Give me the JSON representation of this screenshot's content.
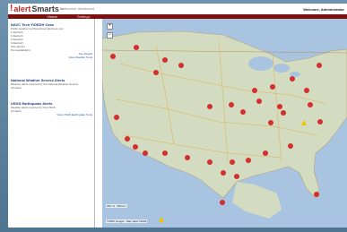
{
  "header": {
    "logo_bang": "!",
    "logo_alert": "alert",
    "logo_smarts": "Smarts",
    "logo_tm": "™",
    "product_text": "Enterprise dashboard",
    "welcome": "Welcome, Administrator"
  },
  "nav": {
    "home_label": "Home",
    "tab_label": "Settings"
  },
  "sidebar": {
    "panels": [
      {
        "title": "NAVC Tech Y/DEDH Cass",
        "lines": [
          "Public weather-vs Place/cloud alerts-ac.com",
          "1 Alerts(3)",
          "3 Alerts(4)",
          "1 Alerts(2)",
          "3 Alerts(2)",
          "UGI alert(1)",
          "Tool available(1)"
        ],
        "links": [
          "See Details",
          "View Weather Tools"
        ]
      },
      {
        "title": "National Weather Service Alerts",
        "lines": [
          "Weather alerts reported by the National Weather Service",
          "(5) alerts"
        ],
        "links": []
      },
      {
        "title": "USGS Earthquake Alerts",
        "lines": [
          "Weather alerts reported by the USGS",
          "(3) alerts"
        ],
        "links": [
          "View USGS Earthquake Tools"
        ]
      }
    ]
  },
  "map": {
    "zoom_in": "+",
    "zoom_out": "−",
    "scale": "200 mi · 500 km",
    "copyright": "©2009 Google - Map data ©2009",
    "pin_color": "#d32f2f",
    "warning_color": "#f2c200"
  }
}
